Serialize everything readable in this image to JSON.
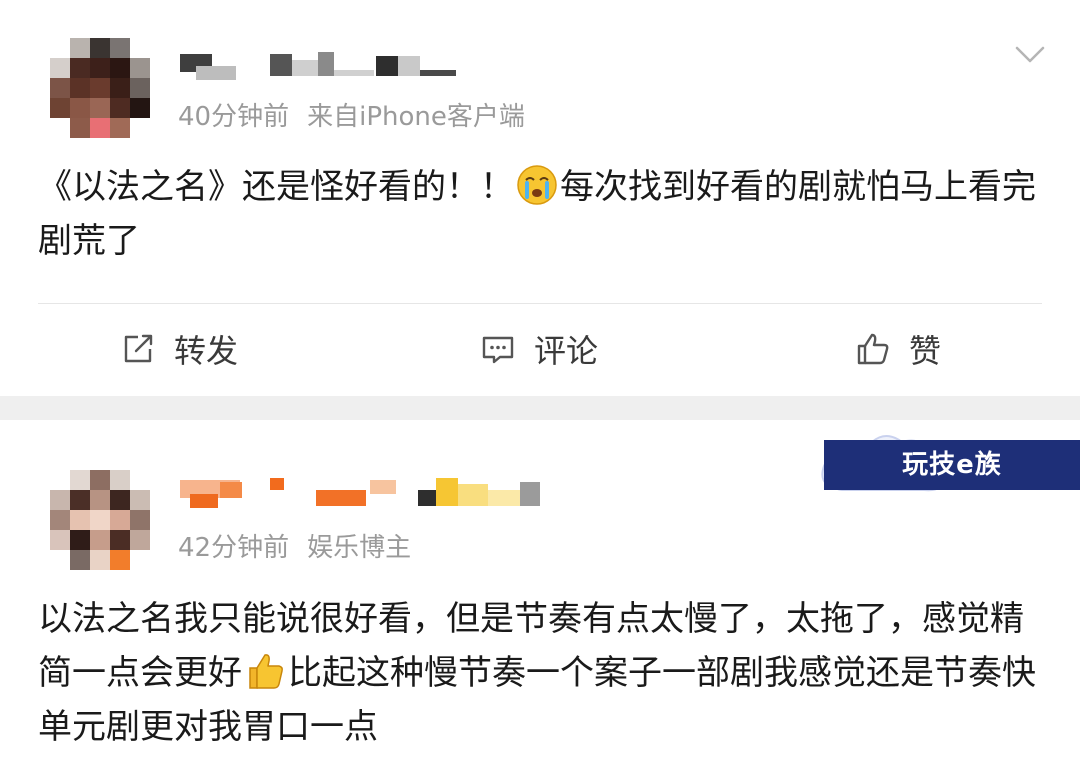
{
  "posts": [
    {
      "time": "40分钟前",
      "source": "来自iPhone客户端",
      "content_part1": "《以法之名》还是怪好看的！！",
      "emoji1": "crying-face",
      "content_part2": "每次找到好看的剧就怕马上看完剧荒了",
      "actions": {
        "repost": "转发",
        "comment": "评论",
        "like": "赞"
      }
    },
    {
      "time": "42分钟前",
      "source": "娱乐博主",
      "content_part1": "以法之名我只能说很好看，但是节奏有点太慢了，太拖了，感觉精简一点会更好",
      "emoji1": "thumbs-up",
      "content_part2": "比起这种慢节奏一个案子一部剧我感觉还是节奏快单元剧更对我胃口一点"
    }
  ],
  "watermark": {
    "text": "玩技e族"
  },
  "colors": {
    "meta_gray": "#9a9a9a",
    "divider": "#e6e6e6",
    "watermark_bar": "#1e2f78",
    "section_gap": "#efefef"
  }
}
